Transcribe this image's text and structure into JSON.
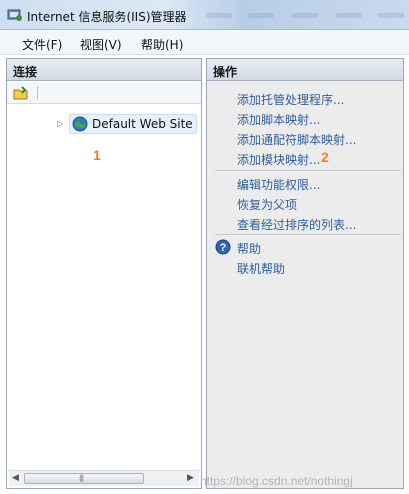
{
  "window": {
    "title": "Internet 信息服务(IIS)管理器"
  },
  "menu": {
    "items": [
      "文件(F)",
      "视图(V)",
      "帮助(H)"
    ]
  },
  "connections": {
    "header": "连接",
    "tree": {
      "site_label": "Default Web Site"
    }
  },
  "actions": {
    "header": "操作",
    "group1": [
      "添加托管处理程序...",
      "添加脚本映射...",
      "添加通配符脚本映射...",
      "添加模块映射..."
    ],
    "group2": [
      "编辑功能权限...",
      "恢复为父项",
      "查看经过排序的列表..."
    ],
    "group3": [
      "帮助",
      "联机帮助"
    ]
  },
  "annotations": {
    "marker1": "1",
    "marker2": "2"
  },
  "watermark": "https://blog.csdn.net/nothingj",
  "colors": {
    "link": "#2f5f9c",
    "marker": "#e8822a",
    "panel_header": "#cfd8e4"
  }
}
